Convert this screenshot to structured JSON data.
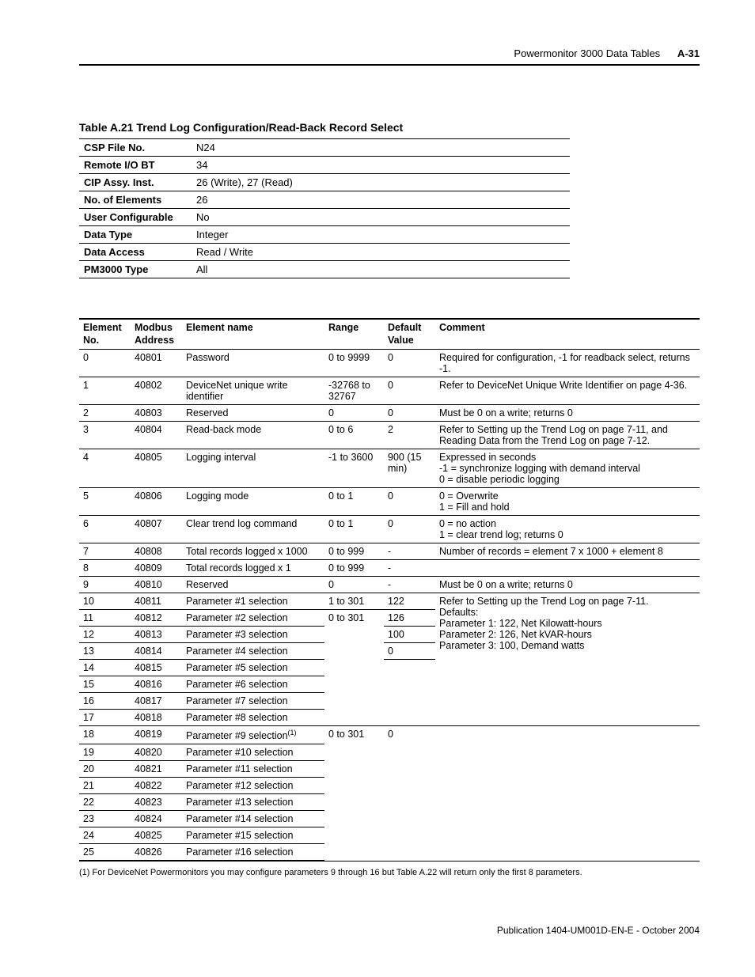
{
  "header": {
    "title": "Powermonitor 3000 Data Tables",
    "page": "A-31"
  },
  "caption": "Table A.21 Trend Log Configuration/Read-Back Record Select",
  "meta": [
    {
      "k": "CSP File No.",
      "v": "N24"
    },
    {
      "k": "Remote I/O BT",
      "v": "34"
    },
    {
      "k": "CIP Assy. Inst.",
      "v": "26 (Write), 27 (Read)"
    },
    {
      "k": "No. of Elements",
      "v": "26"
    },
    {
      "k": "User Configurable",
      "v": "No"
    },
    {
      "k": "Data Type",
      "v": "Integer"
    },
    {
      "k": "Data Access",
      "v": "Read / Write"
    },
    {
      "k": "PM3000 Type",
      "v": "All"
    }
  ],
  "cols": {
    "el": "Element No.",
    "mb": "Modbus Address",
    "nm": "Element name",
    "rg": "Range",
    "df": "Default Value",
    "cm": "Comment"
  },
  "rows": [
    {
      "el": "0",
      "mb": "40801",
      "nm": "Password",
      "rg": "0 to 9999",
      "df": "0",
      "cm": "Required for configuration, -1 for readback select, returns -1."
    },
    {
      "el": "1",
      "mb": "40802",
      "nm": "DeviceNet unique write identifier",
      "rg": "-32768 to 32767",
      "df": "0",
      "cm": "Refer to DeviceNet Unique Write Identifier on page 4-36."
    },
    {
      "el": "2",
      "mb": "40803",
      "nm": "Reserved",
      "rg": "0",
      "df": "0",
      "cm": "Must be 0 on a write; returns 0"
    },
    {
      "el": "3",
      "mb": "40804",
      "nm": "Read-back mode",
      "rg": "0 to 6",
      "df": "2",
      "cm": "Refer to Setting up the Trend Log on page 7-11, and Reading Data from the Trend Log on page 7-12."
    },
    {
      "el": "4",
      "mb": "40805",
      "nm": "Logging interval",
      "rg": "-1 to 3600",
      "df": "900 (15 min)",
      "cm": "Expressed in seconds\n-1 = synchronize logging with demand interval\n0 = disable periodic logging"
    },
    {
      "el": "5",
      "mb": "40806",
      "nm": "Logging mode",
      "rg": "0 to 1",
      "df": "0",
      "cm": "0 = Overwrite\n1 = Fill and hold"
    },
    {
      "el": "6",
      "mb": "40807",
      "nm": "Clear trend log command",
      "rg": "0 to 1",
      "df": "0",
      "cm": "0 = no action\n1 = clear trend log; returns 0"
    },
    {
      "el": "7",
      "mb": "40808",
      "nm": "Total records logged x 1000",
      "rg": "0 to 999",
      "df": "-",
      "cm": "Number of records = element 7 x 1000 + element 8"
    },
    {
      "el": "8",
      "mb": "40809",
      "nm": "Total records logged x 1",
      "rg": "0 to 999",
      "df": "-",
      "cm": ""
    },
    {
      "el": "9",
      "mb": "40810",
      "nm": "Reserved",
      "rg": "0",
      "df": "-",
      "cm": "Must be 0 on a write; returns 0"
    },
    {
      "el": "10",
      "mb": "40811",
      "nm": "Parameter #1 selection",
      "rg": "1 to 301",
      "df": "122",
      "cm": "Refer to Setting up the Trend Log on page 7-11.\nDefaults:\nParameter 1: 122, Net Kilowatt-hours\nParameter 2: 126, Net kVAR-hours\nParameter 3: 100, Demand watts",
      "cmspan": 8
    },
    {
      "el": "11",
      "mb": "40812",
      "nm": "Parameter #2 selection",
      "rg": "0 to 301",
      "df": "126",
      "rgspan": 7
    },
    {
      "el": "12",
      "mb": "40813",
      "nm": "Parameter #3 selection",
      "df": "100"
    },
    {
      "el": "13",
      "mb": "40814",
      "nm": "Parameter #4 selection",
      "df": "0"
    },
    {
      "el": "14",
      "mb": "40815",
      "nm": "Parameter #5 selection",
      "df": "",
      "dfspan": 4
    },
    {
      "el": "15",
      "mb": "40816",
      "nm": "Parameter #6 selection"
    },
    {
      "el": "16",
      "mb": "40817",
      "nm": "Parameter #7 selection"
    },
    {
      "el": "17",
      "mb": "40818",
      "nm": "Parameter #8 selection"
    },
    {
      "el": "18",
      "mb": "40819",
      "nm": "Parameter #9 selection",
      "sup": "(1)",
      "rg": "0 to 301",
      "df": "0",
      "cm": "",
      "rgspan": 8,
      "dfspan": 8,
      "cmspan": 8
    },
    {
      "el": "19",
      "mb": "40820",
      "nm": "Parameter #10 selection"
    },
    {
      "el": "20",
      "mb": "40821",
      "nm": "Parameter #11 selection"
    },
    {
      "el": "21",
      "mb": "40822",
      "nm": "Parameter #12 selection"
    },
    {
      "el": "22",
      "mb": "40823",
      "nm": "Parameter #13 selection"
    },
    {
      "el": "23",
      "mb": "40824",
      "nm": "Parameter #14 selection"
    },
    {
      "el": "24",
      "mb": "40825",
      "nm": "Parameter #15 selection"
    },
    {
      "el": "25",
      "mb": "40826",
      "nm": "Parameter #16 selection"
    }
  ],
  "footnote": "(1)  For DeviceNet Powermonitors you may configure parameters 9 through 16 but Table A.22 will return only the first 8 parameters.",
  "publication": "Publication 1404-UM001D-EN-E - October 2004"
}
